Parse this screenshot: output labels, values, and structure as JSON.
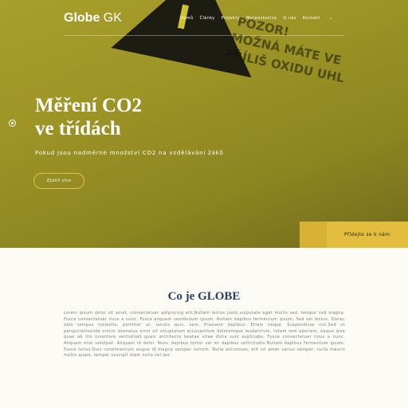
{
  "header": {
    "logo_bold": "Globe",
    "logo_rest": "GK",
    "nav": [
      "Domů",
      "Články",
      "Projekty",
      "Meteostanice",
      "O nás",
      "Kontakt"
    ],
    "nav_more": "›"
  },
  "hero": {
    "title_line1": "Měření CO2",
    "title_line2": "ve třídách",
    "subtitle": "Pokud jsou nadměrné množství CO2 na vzdělávání žáků",
    "cta": "Zjistit více",
    "sign_lines": [
      "POZOR!",
      "MOŽNÁ MÁTE VE",
      "PŘÍLIŠ OXIDU UHL"
    ],
    "side_button": "Přidejte se k nám"
  },
  "about": {
    "title": "Co je GLOBE",
    "text": "Lorem ipsum dolor sit amet, consectetuer adipiscing elit.Nullam lectus justo,vulputate eget mollis sed, tempor sed magna. Fusce consectetuer risus a nunc. Fusce aliquam vestibulum ipsum. Nullam dapibus fermentum ipsum. Sed vel lectus. Donec odio tempus molestie, porttitor ut, iaculis quis, sem. Praesent dapibus. Etiam neque. Suspendisse nisl.Sed ut perspiciatisunde omnis istenatus error sit voluptatem accusantium doloremque laudantium, totam rem aperiam, eaque ipsa quae ab illo inventore veritatiset quasi architecto beatae vitae dicta sunt explicabo. Fusce consectetuer risus a nunc. Aliquam erat volutpat. Aliquam id dolor. Nunc dapibus tortor vel mi dapibus sollicitudin.Nullam dapibus fermentum ipsum. Fusce tellus.Duis condimentum augue id magna semper rutrum. Nulla accumsan, elit sit amet varius semper, nulla mauris mollis quam, tempor suscipit diam nulla vel leo."
  },
  "colors": {
    "accent": "#e2bd3e",
    "title_blue": "#2a4060"
  }
}
